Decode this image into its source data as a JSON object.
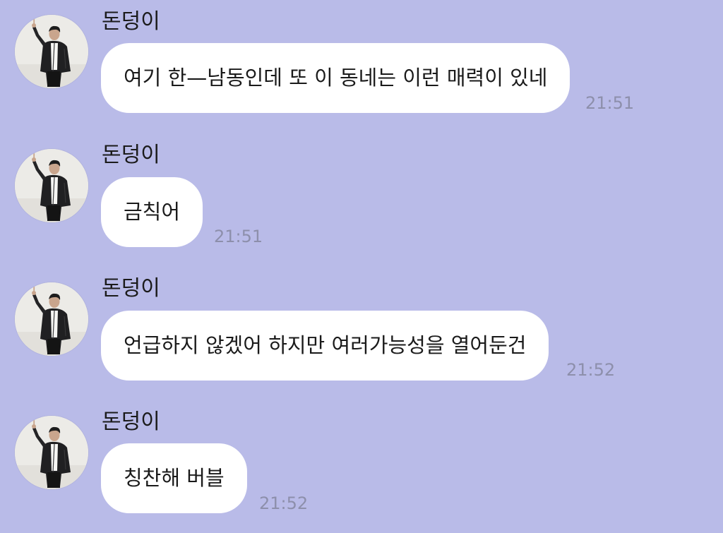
{
  "colors": {
    "background": "#b9bbe8",
    "bubble": "#ffffff",
    "timestamp": "#8d8fab"
  },
  "messages": [
    {
      "sender": "돈덩이",
      "text": "여기 한—남동인데 또 이 동네는 이런 매력이 있네",
      "time": "21:51"
    },
    {
      "sender": "돈덩이",
      "text": "금칙어",
      "time": "21:51"
    },
    {
      "sender": "돈덩이",
      "text": "언급하지 않겠어 하지만 여러가능성을 열어둔건",
      "time": "21:52"
    },
    {
      "sender": "돈덩이",
      "text": "칭찬해 버블",
      "time": "21:52"
    }
  ]
}
